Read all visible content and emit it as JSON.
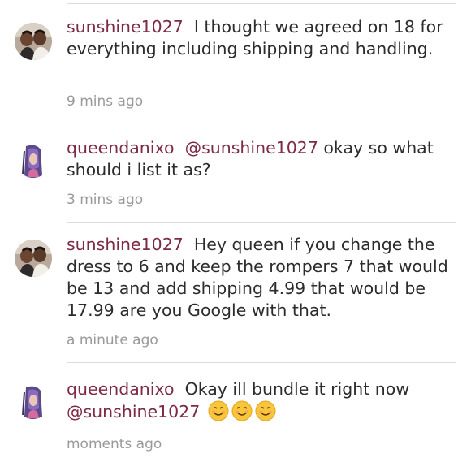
{
  "comments": [
    {
      "username": "sunshine1027",
      "text": "I thought we agreed on 18 for everything including shipping and handling.",
      "timestamp": "9 mins ago",
      "avatar": "couple-photo-avatar"
    },
    {
      "username": "queendanixo",
      "mention": "@sunshine1027",
      "text": "okay so what should i list it as?",
      "timestamp": "3 mins ago",
      "avatar": "purple-hair-avatar"
    },
    {
      "username": "sunshine1027",
      "text": "Hey queen if you change the dress to 6 and keep the rompers 7 that would be 13 and add shipping 4.99 that would be 17.99 are you Google with that.",
      "timestamp": "a minute ago",
      "avatar": "couple-photo-avatar"
    },
    {
      "username": "queendanixo",
      "text": "Okay ill bundle it right now",
      "mention": "@sunshine1027",
      "emojis": [
        "smiling-face-emoji",
        "smiling-face-emoji",
        "smiling-face-emoji"
      ],
      "timestamp": "moments ago",
      "avatar": "purple-hair-avatar"
    }
  ],
  "colors": {
    "username": "#7e2a45",
    "text": "#2c2c2c",
    "timestamp": "#9a9a9a",
    "divider": "#dcdcdc"
  }
}
